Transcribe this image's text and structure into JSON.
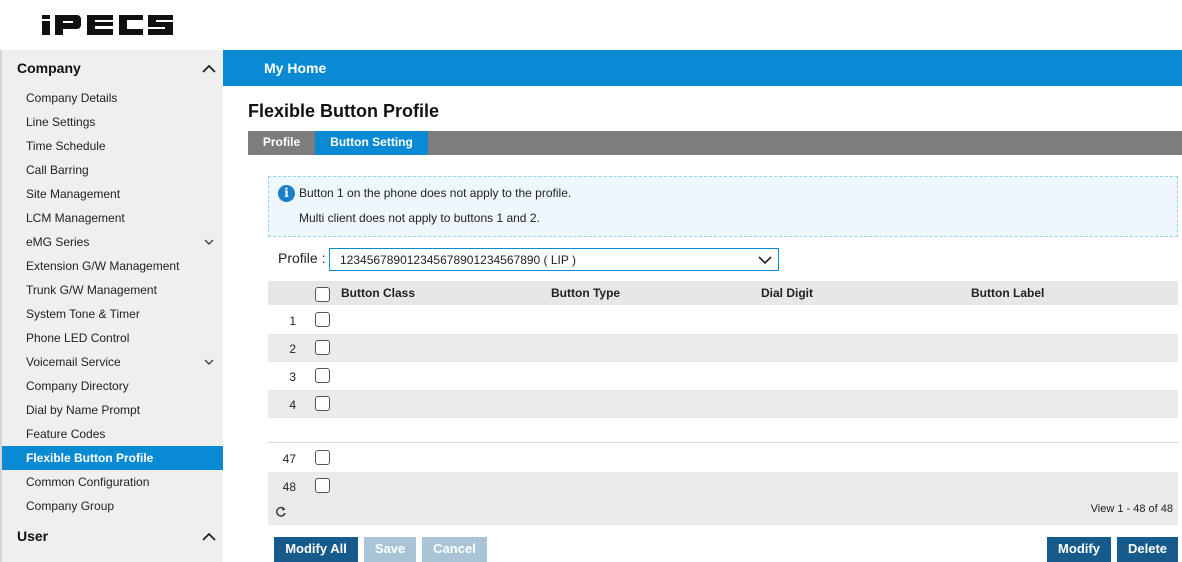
{
  "header": {
    "logo_text": "iPECS"
  },
  "sidebar": {
    "sections": [
      {
        "title": "Company"
      },
      {
        "title": "User"
      }
    ],
    "items": [
      {
        "label": "Company Details"
      },
      {
        "label": "Line Settings"
      },
      {
        "label": "Time Schedule"
      },
      {
        "label": "Call Barring"
      },
      {
        "label": "Site Management"
      },
      {
        "label": "LCM Management"
      },
      {
        "label": "eMG Series"
      },
      {
        "label": "Extension G/W Management"
      },
      {
        "label": "Trunk G/W Management"
      },
      {
        "label": "System Tone & Timer"
      },
      {
        "label": "Phone LED Control"
      },
      {
        "label": "Voicemail Service"
      },
      {
        "label": "Company Directory"
      },
      {
        "label": "Dial by Name Prompt"
      },
      {
        "label": "Feature Codes"
      },
      {
        "label": "Flexible Button Profile"
      },
      {
        "label": "Common Configuration"
      },
      {
        "label": "Company Group"
      }
    ]
  },
  "main": {
    "home_title": "My Home",
    "page_title": "Flexible Button Profile",
    "tabs": [
      {
        "label": "Profile"
      },
      {
        "label": "Button Setting"
      }
    ],
    "notice": {
      "line1": "Button 1 on the phone does not apply to the profile.",
      "line2": "Multi client does not apply to buttons 1 and 2."
    },
    "profile_label": "Profile :",
    "profile_value": "12345678901234567890123456789​0 ( LIP )",
    "table": {
      "columns": [
        "Button Class",
        "Button Type",
        "Dial Digit",
        "Button Label"
      ],
      "rows": [
        "1",
        "2",
        "3",
        "4",
        "47",
        "48"
      ]
    },
    "pager_text": "View 1 - 48 of 48",
    "buttons": {
      "modify_all": "Modify All",
      "save": "Save",
      "cancel": "Cancel",
      "modify": "Modify",
      "delete": "Delete"
    }
  },
  "colors": {
    "accent": "#0a8ad2",
    "button": "#175b8c",
    "tabbar": "#7d7d7d"
  }
}
